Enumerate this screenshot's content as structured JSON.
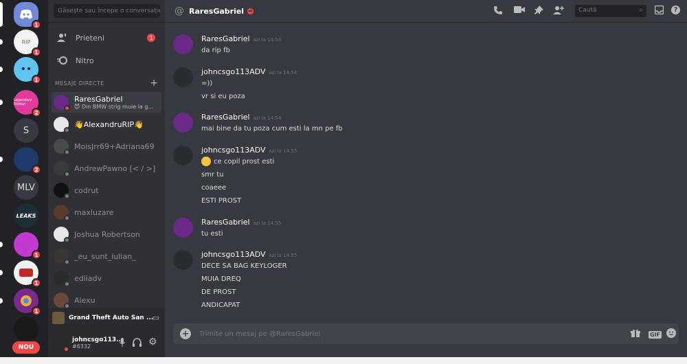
{
  "servers": [
    {
      "name": "home-server",
      "badge": "1"
    },
    {
      "name": "rip-server",
      "badge": "1"
    },
    {
      "name": "blue-face-server",
      "badge": "1"
    },
    {
      "name": "pink-server",
      "label": "Legendary Edition",
      "badge": "2"
    },
    {
      "name": "s-server",
      "label": "S"
    },
    {
      "name": "game-server",
      "badge": "2"
    },
    {
      "name": "mlv-server",
      "label": "MLV"
    },
    {
      "name": "leaks-server",
      "label": "LEAKS"
    },
    {
      "name": "synthwave-server",
      "badge": "1"
    },
    {
      "name": "red-server",
      "badge": "1"
    },
    {
      "name": "chrome-server",
      "badge": "1"
    },
    {
      "name": "dark-server"
    }
  ],
  "new_label": "NOU",
  "sidebar": {
    "search_placeholder": "Găsește sau începe o conversație",
    "friends_label": "Prieteni",
    "friends_badge": "1",
    "nitro_label": "Nitro",
    "dm_header": "MESAJE DIRECTE",
    "dms": [
      {
        "name": "RaresGabriel",
        "sub": "😈 Din BMW strig muie la g...",
        "status": "dnd",
        "color": "#6b2a8a"
      },
      {
        "name": "👋AlexandruRIP👋",
        "sub": "",
        "status": "offline",
        "color": "#e8e8e8"
      },
      {
        "name": "MoisJrr69+Adriana69",
        "sub": "",
        "status": "offline",
        "color": "#4a4a4a"
      },
      {
        "name": "AndrewPawno [< / >]",
        "sub": "",
        "status": "offline",
        "color": "#3a3a3a"
      },
      {
        "name": "codrut",
        "sub": "",
        "status": "offline",
        "color": "#111111"
      },
      {
        "name": "maxluzare",
        "sub": "",
        "status": "offline",
        "color": "#5a3a2a"
      },
      {
        "name": "Joshua Robertson",
        "sub": "",
        "status": "offline",
        "color": "#e8e8e8"
      },
      {
        "name": "_eu_sunt_iulian_",
        "sub": "",
        "status": "offline",
        "color": "#3a3530"
      },
      {
        "name": "ediiadv",
        "sub": "",
        "status": "offline",
        "color": "#2a2a2a"
      },
      {
        "name": "Alexu",
        "sub": "",
        "status": "offline",
        "color": "#6a4a3a"
      }
    ],
    "game_title": "Grand Theft Auto San ...",
    "user_name": "johncsgo113...",
    "user_tag": "#6332"
  },
  "chat": {
    "channel_name": "RaresGabriel",
    "search_placeholder": "Caută",
    "composer_placeholder": "Trimite un mesaj pe @RaresGabriel",
    "groups": [
      {
        "author": "RaresGabriel",
        "time": "azi la 14:53",
        "lines": [
          "da rip fb"
        ],
        "color": "#6b2a8a"
      },
      {
        "author": "johncsgo113ADV",
        "time": "azi la 14:54",
        "lines": [
          "=))",
          "vr si eu poza"
        ],
        "color": "#2a2d30"
      },
      {
        "author": "RaresGabriel",
        "time": "azi la 14:54",
        "lines": [
          "mai bine da tu poza cum esti la mn pe fb"
        ],
        "color": "#6b2a8a"
      },
      {
        "author": "johncsgo113ADV",
        "time": "azi la 14:55",
        "lines": [
          "ce copil prost esti",
          "smr tu",
          "coaeee",
          "ESTI PROST"
        ],
        "color": "#2a2d30"
      },
      {
        "author": "RaresGabriel",
        "time": "azi la 14:55",
        "lines": [
          "tu esti"
        ],
        "color": "#6b2a8a"
      },
      {
        "author": "johncsgo113ADV",
        "time": "azi la 14:55",
        "lines": [
          "DECE SA BAG KEYLOGER",
          "MUIA DREQ",
          "DE PROST",
          "ANDICAPAT"
        ],
        "color": "#2a2d30"
      }
    ]
  },
  "colors": {
    "accent": "#7289da",
    "danger": "#f04747"
  }
}
